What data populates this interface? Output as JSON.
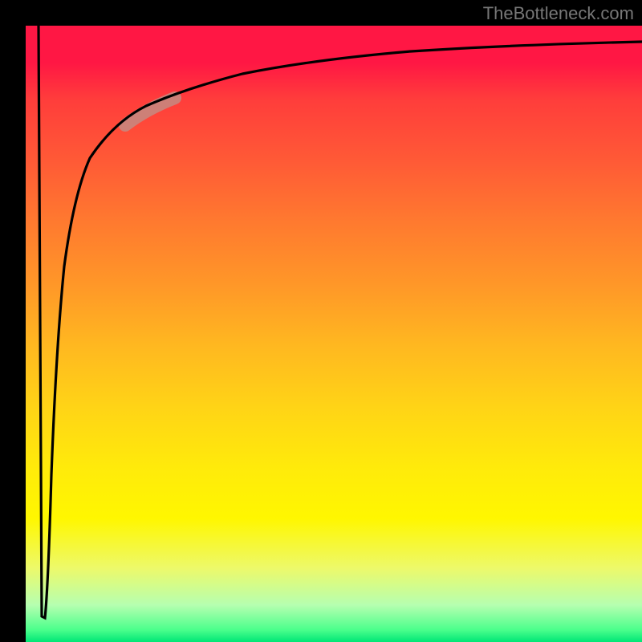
{
  "watermark": "TheBottleneck.com",
  "chart_data": {
    "type": "line",
    "title": "",
    "xlabel": "",
    "ylabel": "",
    "xlim": [
      0,
      100
    ],
    "ylim": [
      0,
      100
    ],
    "background_gradient": {
      "top": "#ff1744",
      "mid_upper": "#ff9728",
      "mid": "#ffeb0a",
      "mid_lower": "#edf96a",
      "bottom": "#00e676"
    },
    "series": [
      {
        "name": "curve",
        "x": [
          2,
          2.3,
          2.5,
          3,
          4,
          6,
          10,
          15,
          22,
          35,
          55,
          75,
          100
        ],
        "y": [
          100,
          50,
          4,
          28,
          55,
          70,
          79,
          84,
          88,
          91.5,
          94,
          95.5,
          97
        ],
        "note": "y is plotted as distance from top; values estimated from pixel positions"
      }
    ],
    "highlight_segment": {
      "x_range": [
        16,
        24
      ],
      "y_range": [
        84,
        89
      ],
      "color": "#c48b82"
    }
  }
}
